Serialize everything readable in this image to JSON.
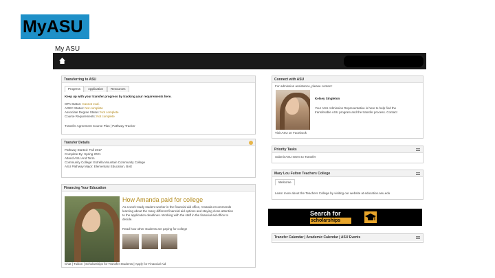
{
  "slide_title": "MyASU",
  "page_title": "My ASU",
  "transferring": {
    "title": "Transferring to ASU",
    "tabs": [
      "Progress",
      "Application",
      "Resources"
    ],
    "intro": "Keep up with your transfer progress by tracking your requirements here.",
    "lines": [
      {
        "label": "GPA Status:",
        "value": "Cannot eval."
      },
      {
        "label": "AGEC Status:",
        "value": "Not complete"
      },
      {
        "label": "Associate Degree Status:",
        "value": "Not complete"
      },
      {
        "label": "Course Requirements:",
        "value": "Not complete"
      }
    ],
    "links": "Transfer Agreement Course Plan | Pathway Tracker"
  },
  "transfer_details": {
    "title": "Transfer Details",
    "lines": [
      "Pathway Started: Fall 2017",
      "Complete By: Spring 2021",
      "Attend ASU And Term",
      "Community College: Estrella Mountain Community College",
      "ASU Pathway Major: Elementary Education, BAE"
    ]
  },
  "financing": {
    "title": "Financing Your Education",
    "headline": "How Amanda paid for college",
    "body": [
      "As a work-study student worker in the financial aid office, Amanda recommends",
      "learning about the many different financial aid options and staying close attention",
      "to the application deadlines. Working with the staff in the financial aid office to",
      "decide."
    ],
    "more": "Read how other students are paying for college",
    "footer": "Chat | Tuition | Scholarships for Transfer Students | Apply for Financial Aid"
  },
  "connect": {
    "title": "Connect with ASU",
    "intro": "For admission assistance, please contact:",
    "name": "Kelsey Singleton",
    "body": [
      "Your ASU Admission Representative is here to help find the",
      "transferable ASU program and the transfer process. Contact"
    ],
    "links": "Visit ASU on Facebook"
  },
  "priority": {
    "title": "Priority Tasks",
    "item": "Submit ASU Intent to Transfer"
  },
  "teachers": {
    "title": "Mary Lou Fulton Teachers College",
    "tab": "Welcome",
    "body": "Learn more about the Teachers College by visiting our website at education.asu.edu"
  },
  "banner": {
    "line1": "Search for",
    "line2": "scholarships"
  },
  "calendar": {
    "title": "Transfer Calendar | Academic Calendar | ASU Events"
  }
}
